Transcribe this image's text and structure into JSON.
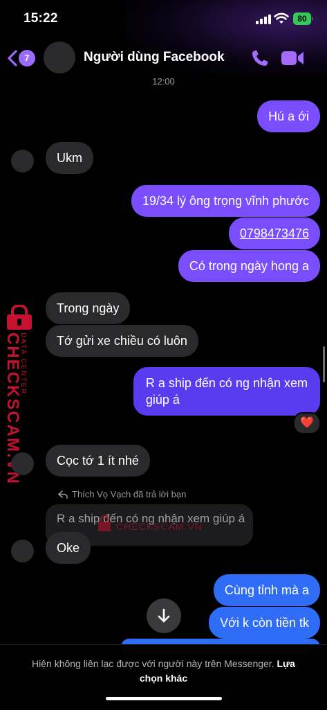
{
  "status_bar": {
    "time": "15:22",
    "battery": "80"
  },
  "header": {
    "back_count": "7",
    "title": "Người dùng Facebook",
    "call_icon": "phone-icon",
    "video_icon": "video-camera-icon"
  },
  "timestamp": "12:00",
  "messages": [
    {
      "dir": "out",
      "text": "Hú a ới"
    },
    {
      "dir": "in",
      "text": "Ukm"
    },
    {
      "dir": "out",
      "text": "19/34 lý ông trọng vĩnh phước"
    },
    {
      "dir": "out",
      "text": "0798473476"
    },
    {
      "dir": "out",
      "text": "Có trong ngày hong a"
    },
    {
      "dir": "in",
      "text": "Trong ngày"
    },
    {
      "dir": "in",
      "text": "Tớ gửi xe chiều có luôn"
    },
    {
      "dir": "out",
      "text_line1": "R a ship đến có ng nhận xem",
      "text_line2": "giúp á",
      "reaction": "❤️"
    },
    {
      "dir": "in",
      "text": "Cọc tớ 1 ít nhé"
    },
    {
      "dir": "in",
      "reply_label": "Thích Vọ Vạch đã trả lời bạn",
      "reply_quote": "R a ship đến có ng nhận xem giúp á",
      "text": "Oke"
    },
    {
      "dir": "out",
      "text": "Cùng tỉnh mà a"
    },
    {
      "dir": "out",
      "text": "Với k còn tiền tk"
    }
  ],
  "watermark": {
    "brand": "CHECKSCAM.VN",
    "sub": "DATA CENTER",
    "center": "CHECKSCAM.VN"
  },
  "footer": {
    "text": "Hiện không liên lạc được với người này trên Messenger.",
    "link": "Lựa chọn khác"
  },
  "colors": {
    "outgoing_purple": "#7a4dff",
    "outgoing_blue": "#2f6df6",
    "incoming": "#2a2a2c",
    "accent": "#9b6bff",
    "watermark_red": "#c4122f"
  }
}
